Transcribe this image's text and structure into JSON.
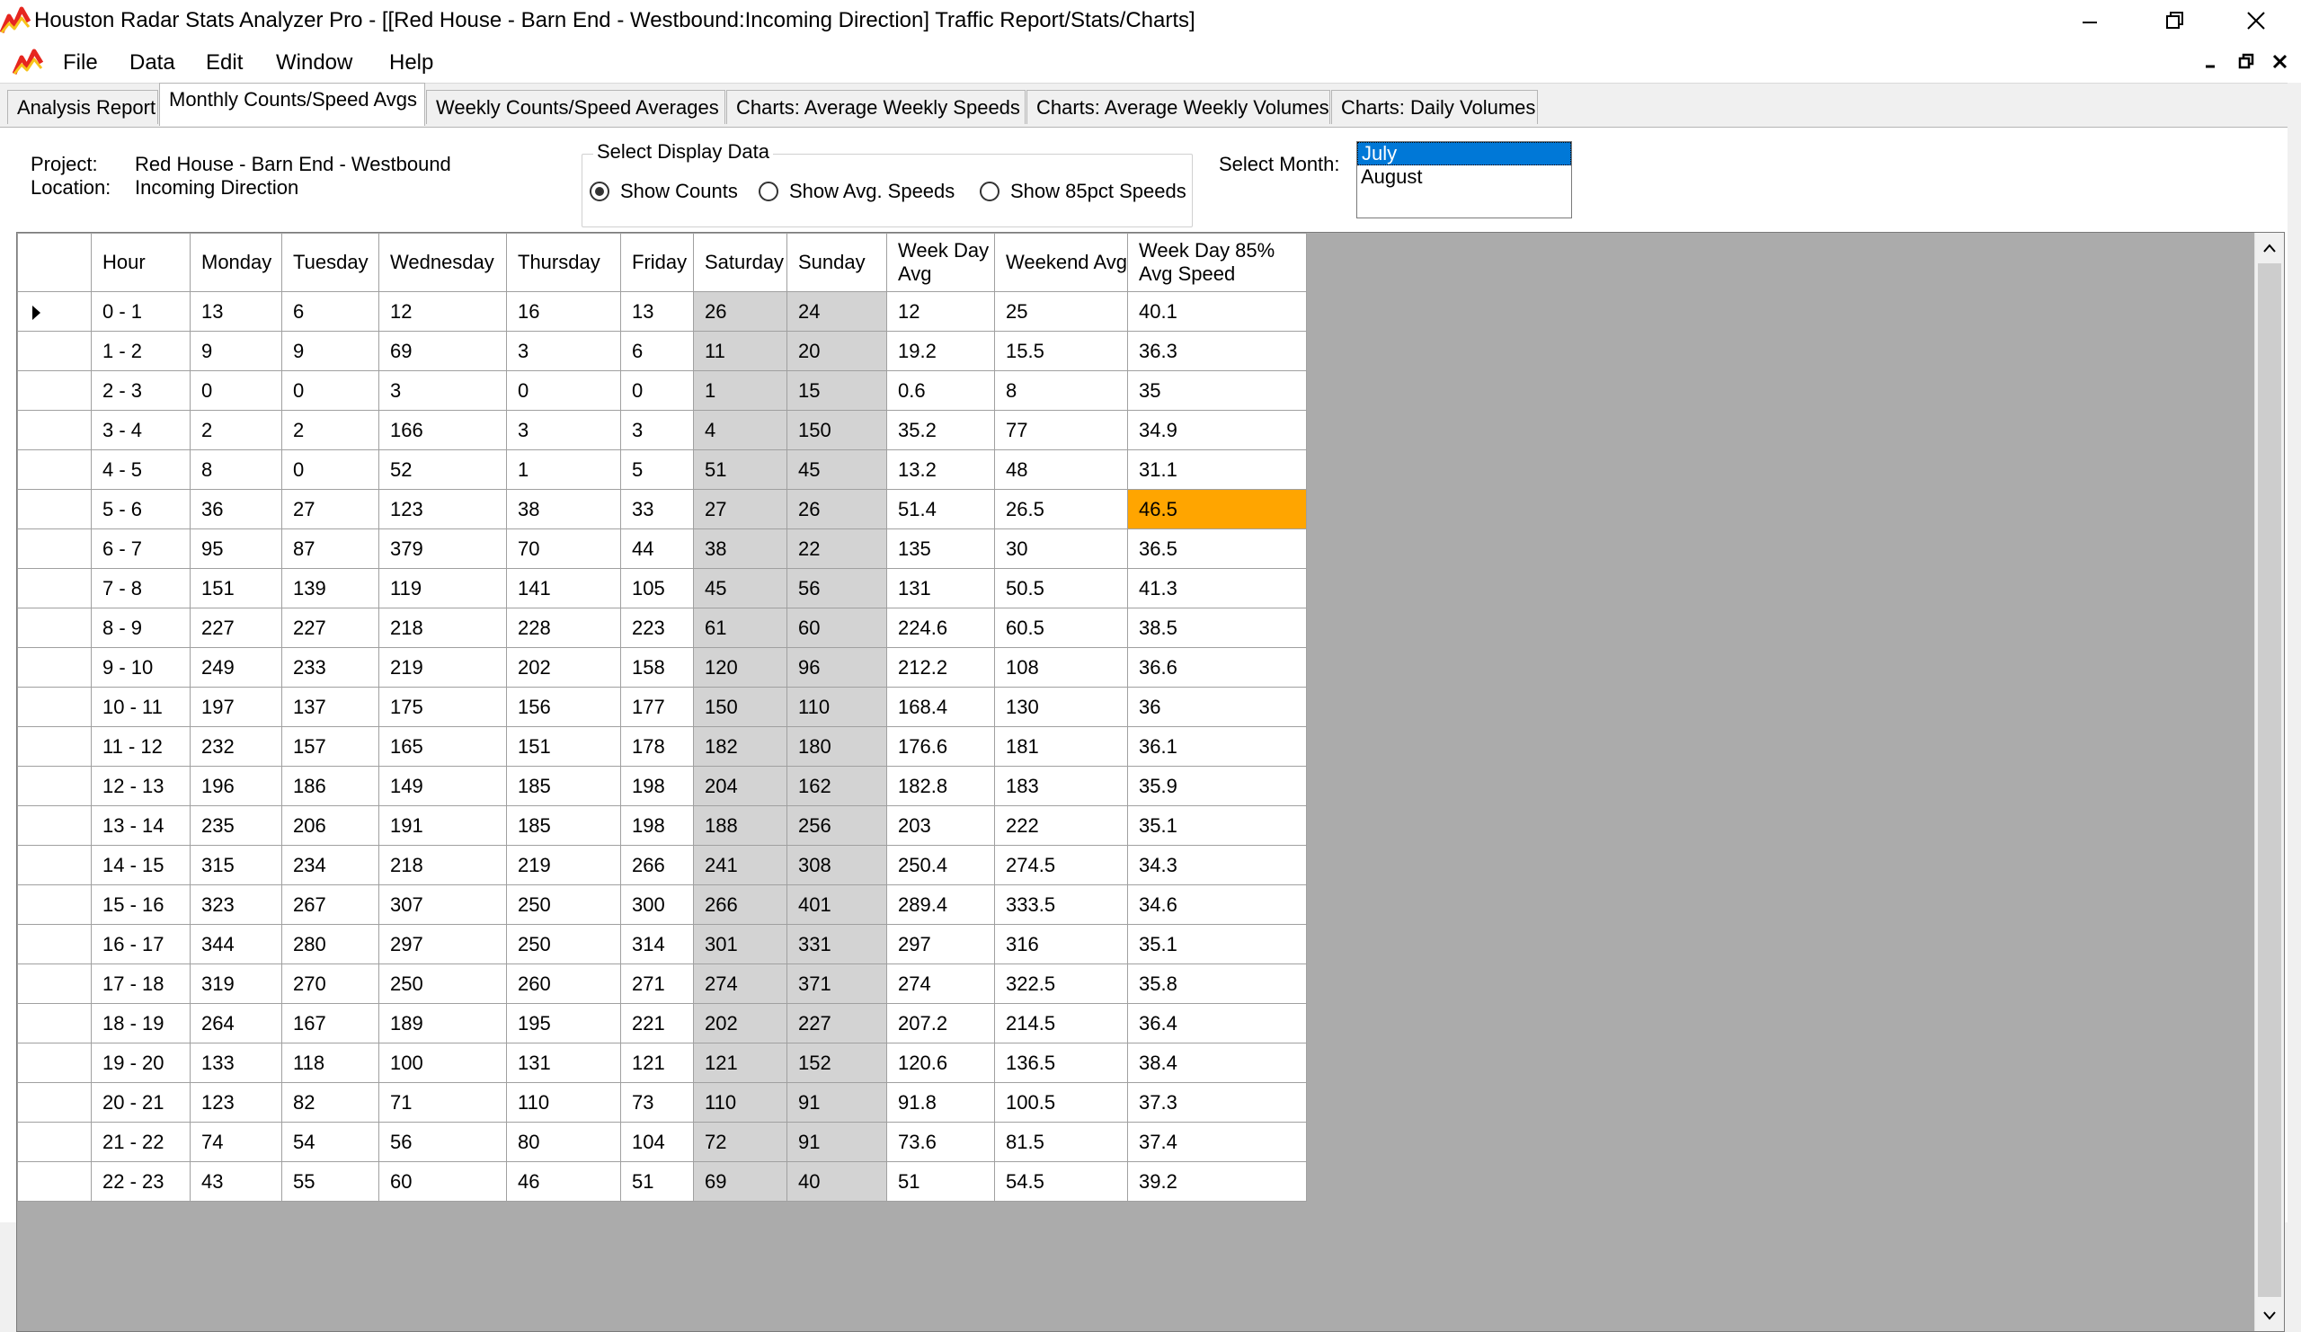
{
  "window": {
    "title": "Houston Radar Stats Analyzer Pro - [[Red House - Barn End - Westbound:Incoming Direction] Traffic Report/Stats/Charts]",
    "app_icon": "app-chart-icon"
  },
  "menu": {
    "items": [
      "File",
      "Data",
      "Edit",
      "Window",
      "Help"
    ]
  },
  "tabs": [
    "Analysis Report",
    "Monthly Counts/Speed Avgs",
    "Weekly Counts/Speed Averages",
    "Charts: Average Weekly Speeds",
    "Charts: Average Weekly Volumes",
    "Charts: Daily Volumes"
  ],
  "active_tab": "Monthly Counts/Speed Avgs",
  "info": {
    "project_label": "Project:",
    "project_value": "Red House - Barn End - Westbound",
    "location_label": "Location:",
    "location_value": "Incoming Direction"
  },
  "display": {
    "group_label": "Select Display Data",
    "options": [
      "Show Counts",
      "Show Avg. Speeds",
      "Show 85pct Speeds"
    ],
    "selected": "Show Counts"
  },
  "month": {
    "label": "Select Month:",
    "options": [
      "July",
      "August"
    ],
    "selected": "July"
  },
  "table": {
    "columns": [
      "Hour",
      "Monday",
      "Tuesday",
      "Wednesday",
      "Thursday",
      "Friday",
      "Saturday",
      "Sunday",
      "Week Day Avg",
      "Weekend Avg",
      "Week Day 85% Avg Speed"
    ],
    "rows": [
      [
        "0 - 1",
        "13",
        "6",
        "12",
        "16",
        "13",
        "26",
        "24",
        "12",
        "25",
        "40.1"
      ],
      [
        "1 - 2",
        "9",
        "9",
        "69",
        "3",
        "6",
        "11",
        "20",
        "19.2",
        "15.5",
        "36.3"
      ],
      [
        "2 - 3",
        "0",
        "0",
        "3",
        "0",
        "0",
        "1",
        "15",
        "0.6",
        "8",
        "35"
      ],
      [
        "3 - 4",
        "2",
        "2",
        "166",
        "3",
        "3",
        "4",
        "150",
        "35.2",
        "77",
        "34.9"
      ],
      [
        "4 - 5",
        "8",
        "0",
        "52",
        "1",
        "5",
        "51",
        "45",
        "13.2",
        "48",
        "31.1"
      ],
      [
        "5 - 6",
        "36",
        "27",
        "123",
        "38",
        "33",
        "27",
        "26",
        "51.4",
        "26.5",
        "46.5"
      ],
      [
        "6 - 7",
        "95",
        "87",
        "379",
        "70",
        "44",
        "38",
        "22",
        "135",
        "30",
        "36.5"
      ],
      [
        "7 - 8",
        "151",
        "139",
        "119",
        "141",
        "105",
        "45",
        "56",
        "131",
        "50.5",
        "41.3"
      ],
      [
        "8 - 9",
        "227",
        "227",
        "218",
        "228",
        "223",
        "61",
        "60",
        "224.6",
        "60.5",
        "38.5"
      ],
      [
        "9 - 10",
        "249",
        "233",
        "219",
        "202",
        "158",
        "120",
        "96",
        "212.2",
        "108",
        "36.6"
      ],
      [
        "10 - 11",
        "197",
        "137",
        "175",
        "156",
        "177",
        "150",
        "110",
        "168.4",
        "130",
        "36"
      ],
      [
        "11 - 12",
        "232",
        "157",
        "165",
        "151",
        "178",
        "182",
        "180",
        "176.6",
        "181",
        "36.1"
      ],
      [
        "12 - 13",
        "196",
        "186",
        "149",
        "185",
        "198",
        "204",
        "162",
        "182.8",
        "183",
        "35.9"
      ],
      [
        "13 - 14",
        "235",
        "206",
        "191",
        "185",
        "198",
        "188",
        "256",
        "203",
        "222",
        "35.1"
      ],
      [
        "14 - 15",
        "315",
        "234",
        "218",
        "219",
        "266",
        "241",
        "308",
        "250.4",
        "274.5",
        "34.3"
      ],
      [
        "15 - 16",
        "323",
        "267",
        "307",
        "250",
        "300",
        "266",
        "401",
        "289.4",
        "333.5",
        "34.6"
      ],
      [
        "16 - 17",
        "344",
        "280",
        "297",
        "250",
        "314",
        "301",
        "331",
        "297",
        "316",
        "35.1"
      ],
      [
        "17 - 18",
        "319",
        "270",
        "250",
        "260",
        "271",
        "274",
        "371",
        "274",
        "322.5",
        "35.8"
      ],
      [
        "18 - 19",
        "264",
        "167",
        "189",
        "195",
        "221",
        "202",
        "227",
        "207.2",
        "214.5",
        "36.4"
      ],
      [
        "19 - 20",
        "133",
        "118",
        "100",
        "131",
        "121",
        "121",
        "152",
        "120.6",
        "136.5",
        "38.4"
      ],
      [
        "20 - 21",
        "123",
        "82",
        "71",
        "110",
        "73",
        "110",
        "91",
        "91.8",
        "100.5",
        "37.3"
      ],
      [
        "21 - 22",
        "74",
        "54",
        "56",
        "80",
        "104",
        "72",
        "91",
        "73.6",
        "81.5",
        "37.4"
      ],
      [
        "22 - 23",
        "43",
        "55",
        "60",
        "46",
        "51",
        "69",
        "40",
        "51",
        "54.5",
        "39.2"
      ]
    ],
    "highlight_cell": {
      "row_hour": "5 - 6",
      "column": "Week Day 85% Avg Speed",
      "color": "#ffa500"
    },
    "weekend_color": "#d3d3d3"
  }
}
